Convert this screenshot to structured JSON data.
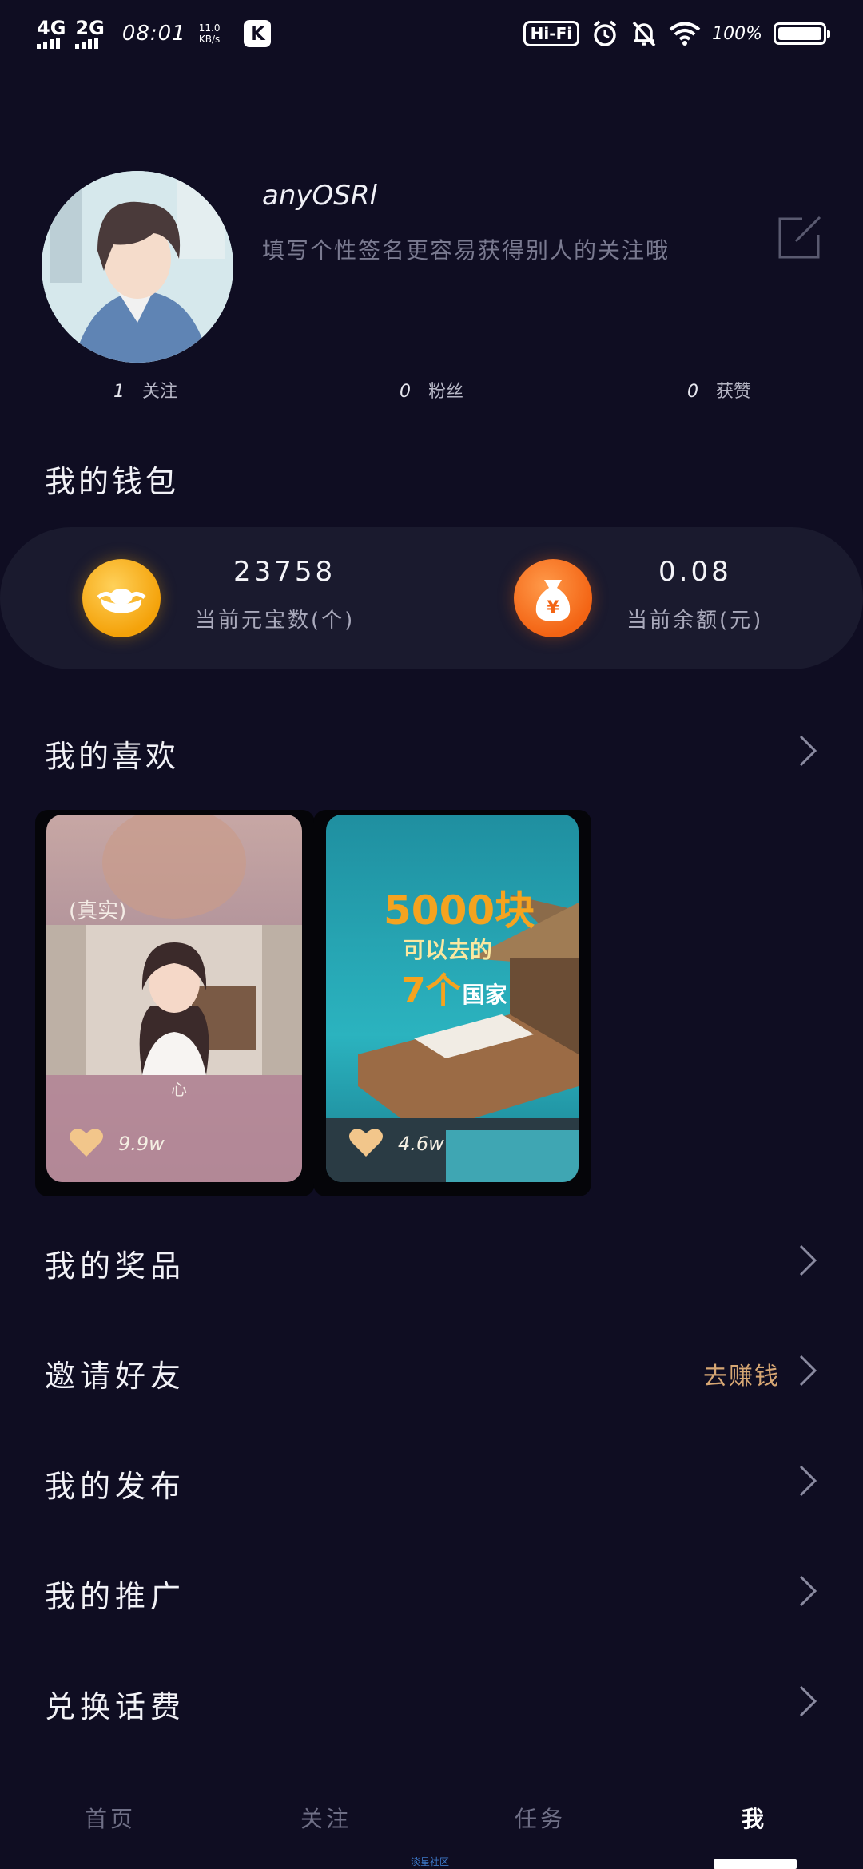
{
  "status_bar": {
    "net1": "4G",
    "net2": "2G",
    "time": "08:01",
    "speed_value": "11.0",
    "speed_unit": "KB/s",
    "app_icon_letter": "K",
    "hifi": "Hi-Fi",
    "battery_pct": "100%",
    "battery_level": 1.0
  },
  "profile": {
    "username": "anyOSRl",
    "signature": "填写个性签名更容易获得别人的关注哦",
    "stats": [
      {
        "num": "1",
        "label": "关注"
      },
      {
        "num": "0",
        "label": "粉丝"
      },
      {
        "num": "0",
        "label": "获赞"
      }
    ]
  },
  "wallet": {
    "title": "我的钱包",
    "ingots_value": "23758",
    "ingots_label": "当前元宝数(个)",
    "balance_value": "0.08",
    "balance_label": "当前余额(元)",
    "money_symbol": "¥"
  },
  "favorites": {
    "title": "我的喜欢",
    "cards": [
      {
        "overlay_top": "(真实)",
        "overlay_bottom": "心",
        "likes": "9.9w"
      },
      {
        "headline": "5000块",
        "line2": "可以去的",
        "line3_num": "7个",
        "line3_text": "国家",
        "likes": "4.6w"
      }
    ]
  },
  "menu": [
    {
      "label": "我的奖品",
      "extra": ""
    },
    {
      "label": "邀请好友",
      "extra": "去赚钱"
    },
    {
      "label": "我的发布",
      "extra": ""
    },
    {
      "label": "我的推广",
      "extra": ""
    },
    {
      "label": "兑换话费",
      "extra": ""
    }
  ],
  "tabs": [
    {
      "label": "首页",
      "active": false
    },
    {
      "label": "关注",
      "active": false
    },
    {
      "label": "任务",
      "active": false
    },
    {
      "label": "我",
      "active": true
    }
  ],
  "watermark": "淡星社区",
  "colors": {
    "background": "#0f0d22",
    "wallet_bg": "#1a1a2e",
    "accent_earn": "#d7a774",
    "coin_gold": "#f4a20a",
    "coin_orange": "#f36414"
  }
}
